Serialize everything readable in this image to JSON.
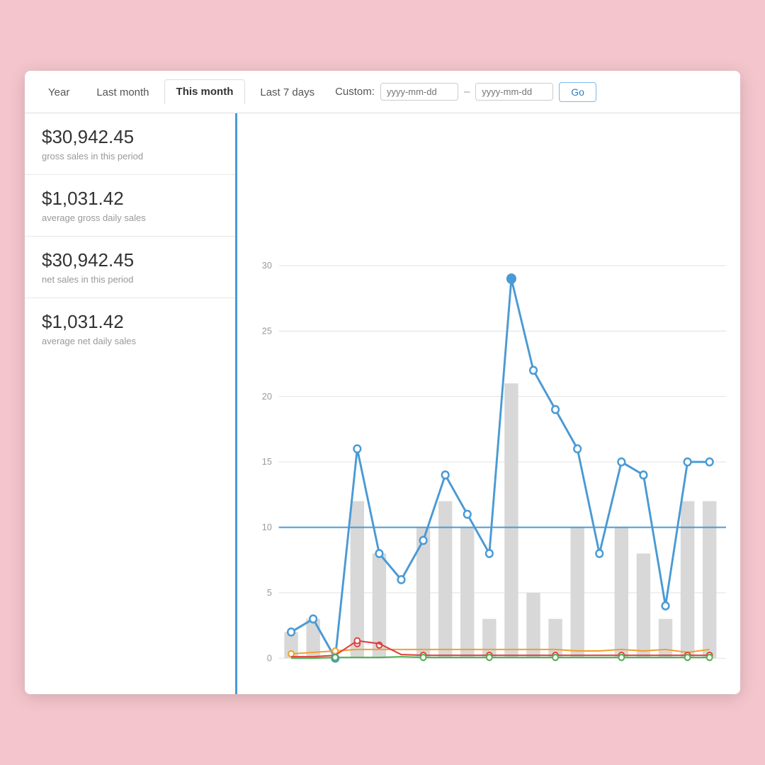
{
  "tabs": [
    {
      "id": "year",
      "label": "Year",
      "active": false
    },
    {
      "id": "last-month",
      "label": "Last month",
      "active": false
    },
    {
      "id": "this-month",
      "label": "This month",
      "active": true
    },
    {
      "id": "last-7-days",
      "label": "Last 7 days",
      "active": false
    }
  ],
  "custom": {
    "label": "Custom:",
    "date1_placeholder": "yyyy-mm-dd",
    "date2_placeholder": "yyyy-mm-dd",
    "separator": "–",
    "go_label": "Go"
  },
  "stats": [
    {
      "value": "$30,942.45",
      "label": "gross sales in this period"
    },
    {
      "value": "$1,031.42",
      "label": "average gross daily sales"
    },
    {
      "value": "$30,942.45",
      "label": "net sales in this period"
    },
    {
      "value": "$1,031.42",
      "label": "average net daily sales"
    }
  ],
  "chart": {
    "y_labels": [
      "0",
      "5",
      "10",
      "15",
      "20",
      "25",
      "30"
    ],
    "accent_color": "#4a9ad4",
    "bar_color": "#d8d8d8",
    "avg_line_color": "#4a9ad4",
    "orange_line_color": "#f0a030",
    "green_line_color": "#50b050",
    "red_line_color": "#e04040"
  }
}
